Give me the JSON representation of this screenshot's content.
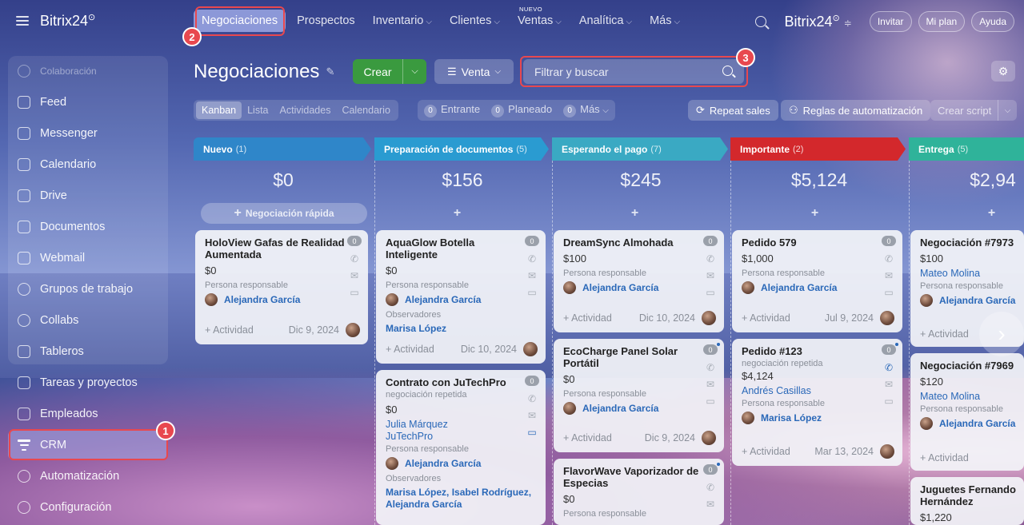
{
  "brand": {
    "name": "Bitrix24",
    "mark": "⊙"
  },
  "sidebar": {
    "items": [
      {
        "label": "Colaboración",
        "icon": "collaboration-icon"
      },
      {
        "label": "Feed",
        "icon": "feed-icon"
      },
      {
        "label": "Messenger",
        "icon": "messenger-icon"
      },
      {
        "label": "Calendario",
        "icon": "calendar-icon"
      },
      {
        "label": "Drive",
        "icon": "drive-icon"
      },
      {
        "label": "Documentos",
        "icon": "documents-icon"
      },
      {
        "label": "Webmail",
        "icon": "webmail-icon"
      },
      {
        "label": "Grupos de trabajo",
        "icon": "workgroups-icon"
      },
      {
        "label": "Collabs",
        "icon": "collabs-icon"
      },
      {
        "label": "Tableros",
        "icon": "boards-icon"
      },
      {
        "label": "Tareas y proyectos",
        "icon": "tasks-icon"
      },
      {
        "label": "Empleados",
        "icon": "employees-icon"
      },
      {
        "label": "CRM",
        "icon": "crm-funnel-icon"
      },
      {
        "label": "Automatización",
        "icon": "automation-icon"
      },
      {
        "label": "Configuración",
        "icon": "settings-icon"
      }
    ]
  },
  "topnav": {
    "items": [
      "Negociaciones",
      "Prospectos",
      "Inventario",
      "Clientes",
      "Ventas",
      "Analítica",
      "Más"
    ],
    "new_tag": "NUEVO",
    "invite": "Invitar",
    "plan": "Mi plan",
    "help": "Ayuda"
  },
  "toolbar": {
    "title": "Negociaciones",
    "create": "Crear",
    "pipeline": "Venta",
    "search_placeholder": "Filtrar y buscar"
  },
  "view_tabs": [
    "Kanban",
    "Lista",
    "Actividades",
    "Calendario"
  ],
  "counters": [
    {
      "count": "0",
      "label": "Entrante"
    },
    {
      "count": "0",
      "label": "Planeado"
    },
    {
      "count": "0",
      "label": "Más"
    }
  ],
  "actions": {
    "repeat_sales": "Repeat sales",
    "automation_rules": "Reglas de automatización",
    "create_script": "Crear script"
  },
  "kanban": {
    "quick_add": "Negociación rápida",
    "activity": "+ Actividad",
    "responsible": "Persona responsable",
    "observers": "Observadores",
    "repeat_deal": "negociación repetida",
    "columns": [
      {
        "name": "Nuevo",
        "count": "(1)",
        "total": "$0",
        "color": "#2f86c9"
      },
      {
        "name": "Preparación de documentos",
        "count": "(5)",
        "total": "$156",
        "color": "#2a9bd1"
      },
      {
        "name": "Esperando el pago",
        "count": "(7)",
        "total": "$245",
        "color": "#3aa9c3"
      },
      {
        "name": "Importante",
        "count": "(2)",
        "total": "$5,124",
        "color": "#d3282c"
      },
      {
        "name": "Entrega",
        "count": "(5)",
        "total": "$2,94",
        "color": "#2fb39a"
      }
    ],
    "cards": {
      "c1": {
        "title": "HoloView Gafas de Realidad Aumentada",
        "amount": "$0",
        "person": "Alejandra García",
        "date": "Dic 9, 2024",
        "badge": "0"
      },
      "c2": {
        "title": "AquaGlow Botella Inteligente",
        "amount": "$0",
        "person": "Alejandra García",
        "observer": "Marisa López",
        "date": "Dic 10, 2024",
        "badge": "0"
      },
      "c3": {
        "title": "Contrato con JuTechPro",
        "amount": "$0",
        "contact": "Julia Márquez",
        "company": "JuTechPro",
        "person": "Alejandra García",
        "observers": "Marisa López, Isabel Rodríguez, Alejandra García",
        "badge": "0"
      },
      "c4": {
        "title": "DreamSync Almohada",
        "amount": "$100",
        "person": "Alejandra García",
        "date": "Dic 10, 2024",
        "badge": "0"
      },
      "c5": {
        "title": "EcoCharge Panel Solar Portátil",
        "amount": "$0",
        "person": "Alejandra García",
        "date": "Dic 9, 2024",
        "badge": "0"
      },
      "c6": {
        "title": "FlavorWave Vaporizador de Especias",
        "amount": "$0",
        "badge": "0"
      },
      "c7": {
        "title": "Pedido 579",
        "amount": "$1,000",
        "person": "Alejandra García",
        "date": "Jul 9, 2024",
        "badge": "0"
      },
      "c8": {
        "title": "Pedido #123",
        "amount": "$4,124",
        "contact": "Andrés Casillas",
        "person": "Marisa López",
        "date": "Mar 13, 2024",
        "badge": "0"
      },
      "c9": {
        "title": "Negociación #7973",
        "amount": "$100",
        "contact": "Mateo Molina",
        "person": "Alejandra García"
      },
      "c10": {
        "title": "Negociación #7969",
        "amount": "$120",
        "contact": "Mateo Molina",
        "person": "Alejandra García"
      },
      "c11": {
        "title": "Juguetes Fernando Hernández",
        "amount": "$1,220"
      }
    }
  },
  "annotations": [
    "1",
    "2",
    "3"
  ]
}
